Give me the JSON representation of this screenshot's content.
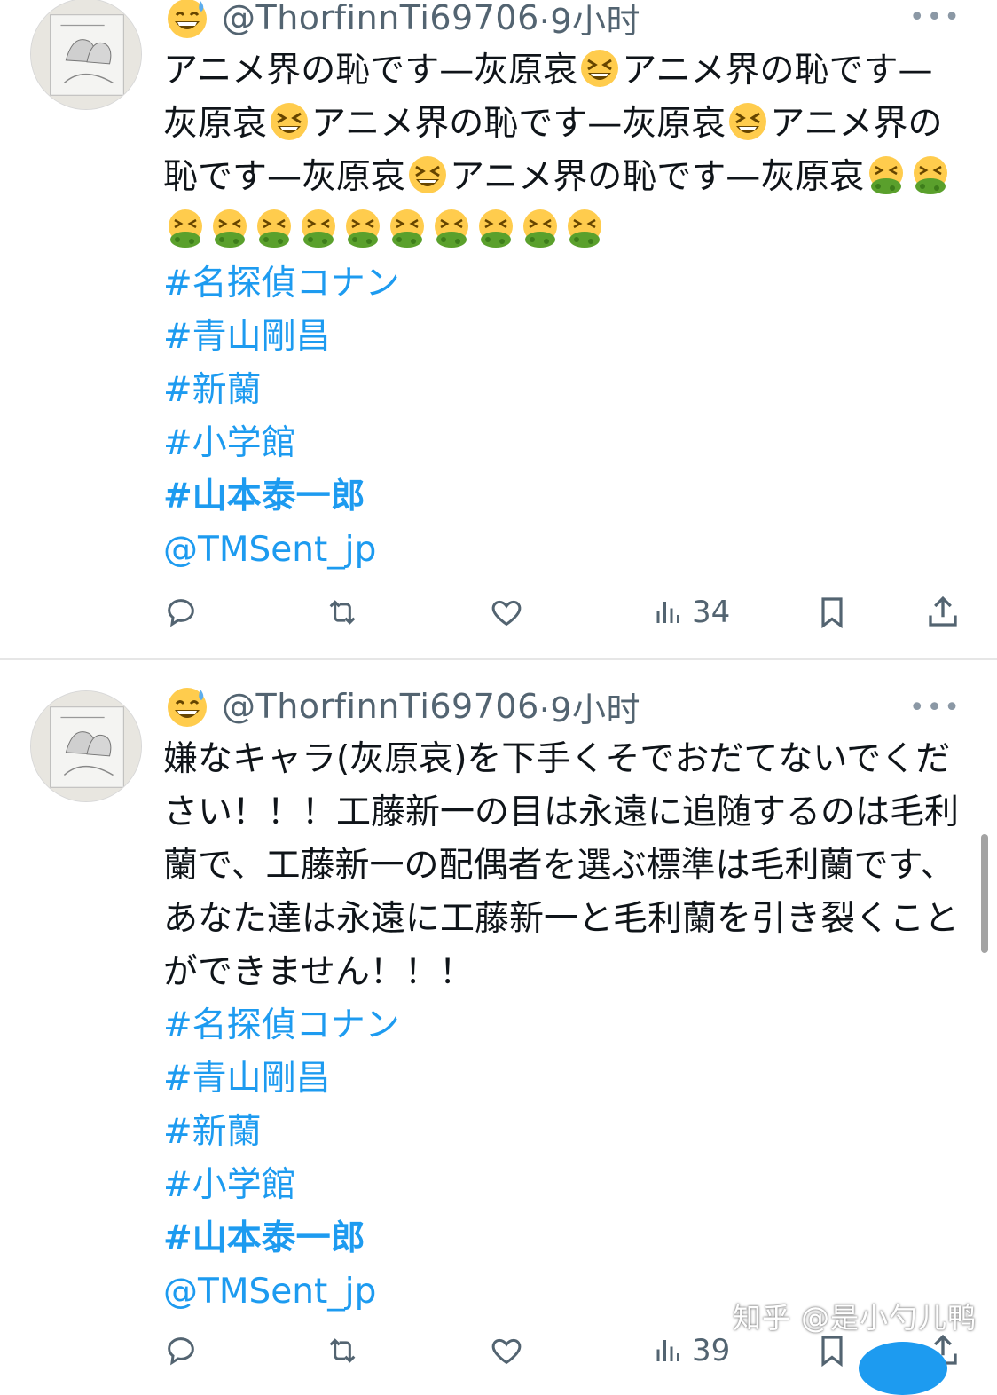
{
  "tweets": [
    {
      "handle": "@ThorfinnTi69706",
      "time": "·9小时",
      "more_label": "•••",
      "text_parts": [
        "アニメ界の恥です—灰原哀",
        "アニメ界の恥です—灰原哀",
        "アニメ界の恥です—灰原哀",
        "アニメ界の恥です—灰原哀",
        "アニメ界の恥です—灰原哀"
      ],
      "trailing_emoji": "nauseated-face",
      "trailing_emoji_count": 12,
      "hashtags": [
        "#名探偵コナン",
        "#青山剛昌",
        "#新蘭",
        "#小学館",
        "#山本泰一郎"
      ],
      "mention": "@TMSent_jp",
      "views": "34"
    },
    {
      "handle": "@ThorfinnTi69706",
      "time": "·9小时",
      "more_label": "•••",
      "text": "嫌なキャラ(灰原哀)を下手くそでおだてないでください！！！工藤新一の目は永遠に追随するのは毛利蘭で、工藤新一の配偶者を選ぶ標準は毛利蘭です、あなた達は永遠に工藤新一と毛利蘭を引き裂くことができません！！！",
      "hashtags": [
        "#名探偵コナン",
        "#青山剛昌",
        "#新蘭",
        "#小学館",
        "#山本泰一郎"
      ],
      "mention": "@TMSent_jp",
      "views": "39"
    }
  ],
  "watermark": "知乎 @是小勺儿鸭",
  "icons": {
    "header_emoji": "grinning-sweat-face",
    "inline_emoji": "laughing-squint-face",
    "reply": "reply-icon",
    "retweet": "retweet-icon",
    "like": "like-icon",
    "views": "views-icon",
    "bookmark": "bookmark-icon",
    "share": "share-icon"
  },
  "colors": {
    "link": "#1d9bf0",
    "muted": "#536471",
    "text": "#0f1419"
  }
}
